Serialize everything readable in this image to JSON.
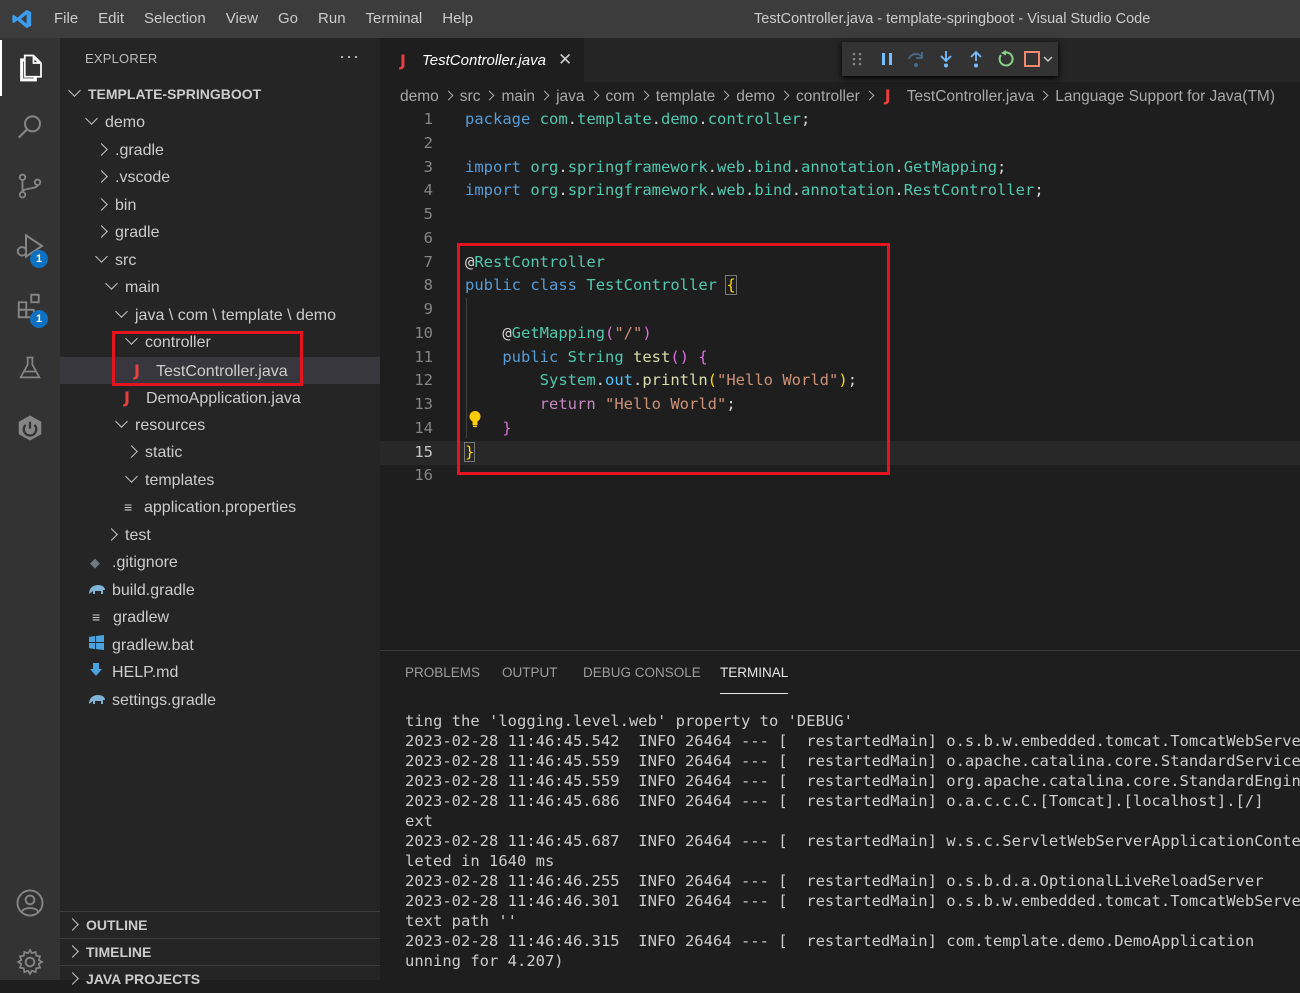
{
  "menu": [
    "File",
    "Edit",
    "Selection",
    "View",
    "Go",
    "Run",
    "Terminal",
    "Help"
  ],
  "window_title": "TestController.java - template-springboot - Visual Studio Code",
  "activity": {
    "run_badge": "1",
    "extensions_badge": "1"
  },
  "explorer": {
    "header": "EXPLORER",
    "root": "TEMPLATE-SPRINGBOOT",
    "items": [
      {
        "label": "demo"
      },
      {
        "label": ".gradle"
      },
      {
        "label": ".vscode"
      },
      {
        "label": "bin"
      },
      {
        "label": "gradle"
      },
      {
        "label": "src"
      },
      {
        "label": "main"
      },
      {
        "label": "java \\ com \\ template \\ demo"
      },
      {
        "label": "controller"
      },
      {
        "label": "TestController.java"
      },
      {
        "label": "DemoApplication.java"
      },
      {
        "label": "resources"
      },
      {
        "label": "static"
      },
      {
        "label": "templates"
      },
      {
        "label": "application.properties"
      },
      {
        "label": "test"
      },
      {
        "label": ".gitignore"
      },
      {
        "label": "build.gradle"
      },
      {
        "label": "gradlew"
      },
      {
        "label": "gradlew.bat"
      },
      {
        "label": "HELP.md"
      },
      {
        "label": "settings.gradle"
      }
    ],
    "sections": [
      "OUTLINE",
      "TIMELINE",
      "JAVA PROJECTS"
    ]
  },
  "editor": {
    "tab_label": "TestController.java",
    "breadcrumb": [
      "demo",
      "src",
      "main",
      "java",
      "com",
      "template",
      "demo",
      "controller",
      "TestController.java",
      "Language Support for Java(TM)"
    ],
    "current_line": 15
  },
  "panel": {
    "tabs": [
      "PROBLEMS",
      "OUTPUT",
      "DEBUG CONSOLE",
      "TERMINAL"
    ],
    "active_tab": "TERMINAL",
    "terminal_lines": [
      "ting the 'logging.level.web' property to 'DEBUG'",
      "2023-02-28 11:46:45.542  INFO 26464 --- [  restartedMain] o.s.b.w.embedded.tomcat.TomcatWebServer",
      "2023-02-28 11:46:45.559  INFO 26464 --- [  restartedMain] o.apache.catalina.core.StandardService",
      "2023-02-28 11:46:45.559  INFO 26464 --- [  restartedMain] org.apache.catalina.core.StandardEngine",
      "2023-02-28 11:46:45.686  INFO 26464 --- [  restartedMain] o.a.c.c.C.[Tomcat].[localhost].[/]",
      "ext",
      "2023-02-28 11:46:45.687  INFO 26464 --- [  restartedMain] w.s.c.ServletWebServerApplicationContext",
      "leted in 1640 ms",
      "2023-02-28 11:46:46.255  INFO 26464 --- [  restartedMain] o.s.b.d.a.OptionalLiveReloadServer",
      "2023-02-28 11:46:46.301  INFO 26464 --- [  restartedMain] o.s.b.w.embedded.tomcat.TomcatWebServer",
      "text path ''",
      "2023-02-28 11:46:46.315  INFO 26464 --- [  restartedMain] com.template.demo.DemoApplication",
      "unning for 4.207)"
    ]
  }
}
